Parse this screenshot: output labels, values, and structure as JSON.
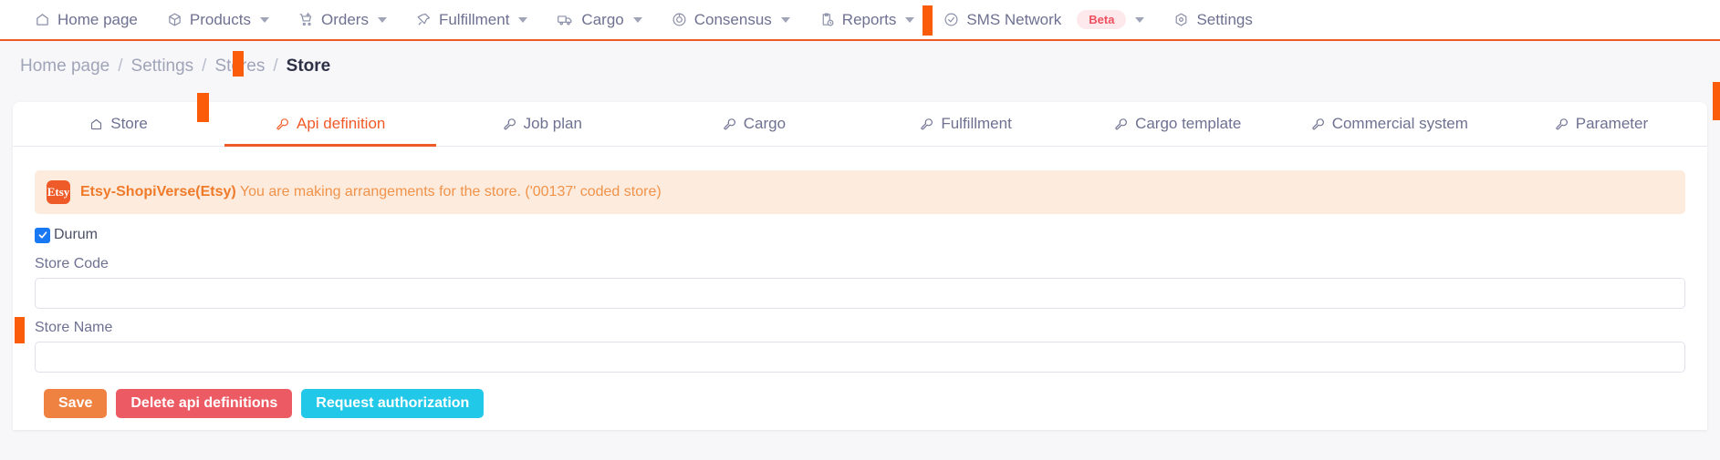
{
  "topnav": {
    "items": [
      {
        "label": "Home page",
        "icon": "home-icon",
        "caret": false
      },
      {
        "label": "Products",
        "icon": "box-icon",
        "caret": true
      },
      {
        "label": "Orders",
        "icon": "cart-plus-icon",
        "caret": true
      },
      {
        "label": "Fulfillment",
        "icon": "pin-icon",
        "caret": true
      },
      {
        "label": "Cargo",
        "icon": "truck-icon",
        "caret": true
      },
      {
        "label": "Consensus",
        "icon": "target-icon",
        "caret": true
      },
      {
        "label": "Reports",
        "icon": "clipboard-clock-icon",
        "caret": true
      },
      {
        "label": "SMS Network",
        "icon": "check-circle-icon",
        "caret": true,
        "badge": "Beta"
      },
      {
        "label": "Settings",
        "icon": "hexagon-gear-icon",
        "caret": false
      }
    ]
  },
  "breadcrumb": {
    "items": [
      "Home page",
      "Settings",
      "Stores",
      "Store"
    ],
    "separator": "/"
  },
  "tabs": [
    {
      "label": "Store",
      "icon": "home-icon",
      "active": false
    },
    {
      "label": "Api definition",
      "icon": "wrench-icon",
      "active": true
    },
    {
      "label": "Job plan",
      "icon": "wrench-icon",
      "active": false
    },
    {
      "label": "Cargo",
      "icon": "wrench-icon",
      "active": false
    },
    {
      "label": "Fulfillment",
      "icon": "wrench-icon",
      "active": false
    },
    {
      "label": "Cargo template",
      "icon": "wrench-icon",
      "active": false
    },
    {
      "label": "Commercial system",
      "icon": "wrench-icon",
      "active": false
    },
    {
      "label": "Parameter",
      "icon": "wrench-icon",
      "active": false
    }
  ],
  "alert": {
    "logo_text": "Etsy",
    "strong": "Etsy-ShopiVerse(Etsy)",
    "message": " You are making arrangements for the store. ('00137' coded store)"
  },
  "form": {
    "checkbox": {
      "label": "Durum",
      "checked": true
    },
    "store_code": {
      "label": "Store Code",
      "value": "",
      "placeholder": ""
    },
    "store_name": {
      "label": "Store Name",
      "value": "",
      "placeholder": ""
    }
  },
  "buttons": {
    "save": "Save",
    "delete": "Delete api definitions",
    "request": "Request authorization"
  },
  "colors": {
    "accent_orange": "#f05a28",
    "marker_orange": "#fa5c0a",
    "save": "#ef8141",
    "delete": "#ec5a63",
    "request": "#22c8e8",
    "checkbox_blue": "#1877f2",
    "alert_bg": "#fdecdd",
    "beta_badge": "#ef4f5f"
  }
}
